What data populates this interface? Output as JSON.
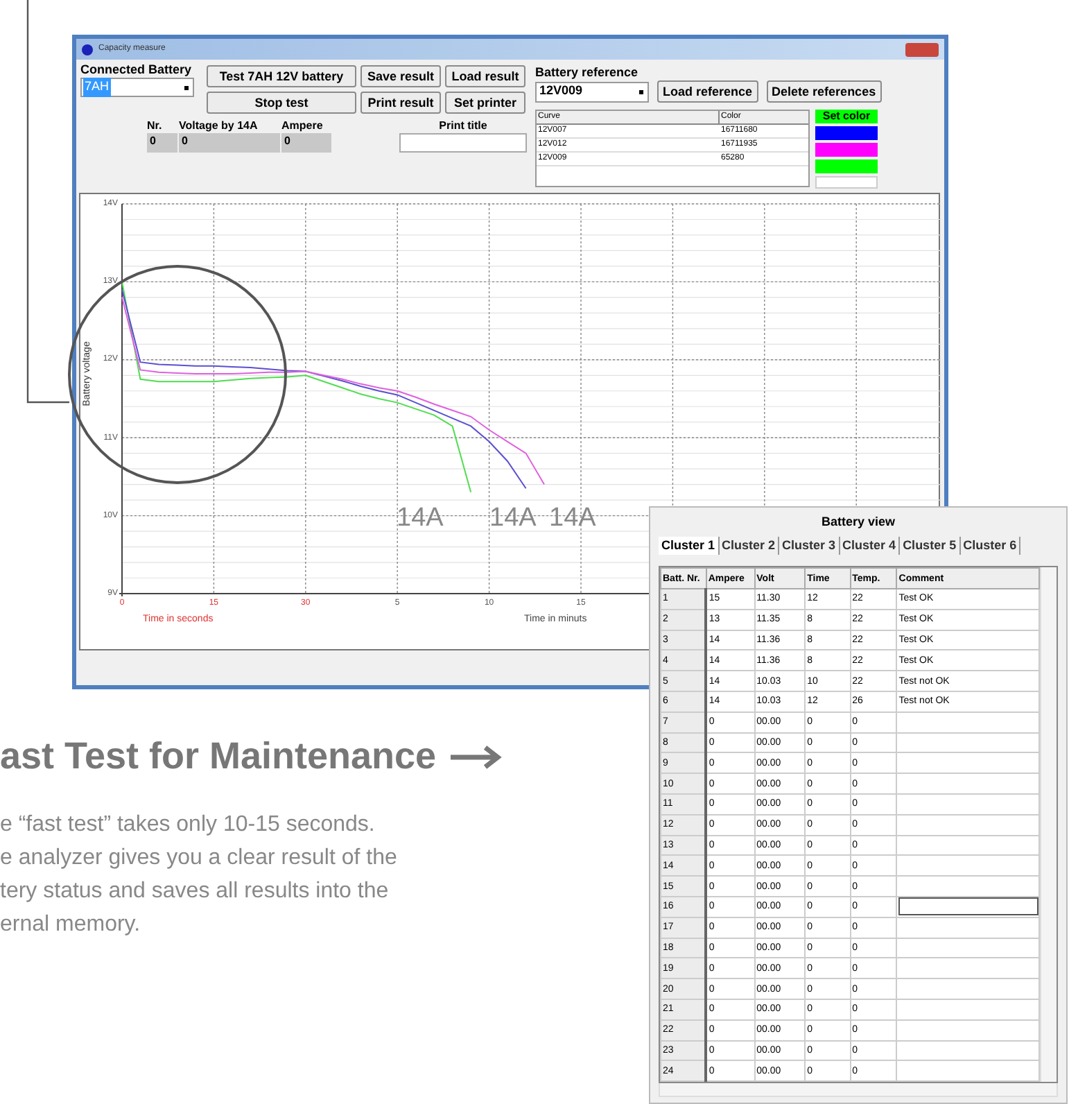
{
  "main_window": {
    "title": "Capacity measure",
    "connected_battery": {
      "label": "Connected Battery",
      "value": "7AH"
    },
    "buttons": [
      "Test 7AH 12V battery",
      "Save result",
      "Load result",
      "Stop test",
      "Print result",
      "Set printer"
    ],
    "readout": {
      "columns": [
        "Nr.",
        "Voltage by 14A",
        "Ampere"
      ],
      "values": [
        "0",
        "0",
        "0"
      ]
    },
    "print_title": {
      "label": "Print title"
    },
    "battery_reference": {
      "label": "Battery reference",
      "value": "12V009",
      "buttons": [
        "Load reference",
        "Delete references"
      ],
      "columns": [
        "Curve",
        "Color"
      ],
      "rows": [
        {
          "curve": "12V007",
          "code": "16711680",
          "color": "#0000ff"
        },
        {
          "curve": "12V012",
          "code": "16711935",
          "color": "#ff00ff"
        },
        {
          "curve": "12V009",
          "code": "65280",
          "color": "#00ff00"
        }
      ],
      "set_color_button": "Set color"
    }
  },
  "chart": {
    "xlabel_seconds": "Time in seconds",
    "xlabel_minutes": "Time in minuts",
    "curve_labels": [
      "14A",
      "14A",
      "14A"
    ],
    "chart_data": {
      "type": "line",
      "ylabel": "Battery voltage",
      "ylim": [
        9,
        14
      ],
      "grid": true,
      "yticks": [
        {
          "value": 14,
          "label": "14V"
        },
        {
          "value": 13,
          "label": "13V"
        },
        {
          "value": 12,
          "label": "12V"
        },
        {
          "value": 11,
          "label": "11V"
        },
        {
          "value": 10,
          "label": "10V"
        },
        {
          "value": 9,
          "label": "9V"
        }
      ],
      "categories": [
        "0",
        null,
        null,
        null,
        null,
        "15",
        null,
        null,
        null,
        null,
        "30",
        null,
        null,
        null,
        null,
        "5",
        null,
        null,
        null,
        null,
        "10",
        null,
        null,
        null,
        null,
        "15"
      ],
      "series": [
        {
          "color": "#50dd50",
          "values": [
            13.0,
            11.75,
            11.72,
            11.72,
            11.72,
            11.72,
            11.74,
            11.76,
            11.77,
            11.78,
            11.8,
            11.72,
            11.64,
            11.56,
            11.5,
            11.45,
            11.37,
            11.29,
            11.15,
            10.3,
            null,
            null,
            null,
            null,
            null,
            null
          ]
        },
        {
          "color": "#5a50d0",
          "values": [
            12.9,
            11.97,
            11.94,
            11.93,
            11.92,
            11.92,
            11.91,
            11.9,
            11.88,
            11.86,
            11.85,
            11.79,
            11.73,
            11.66,
            11.6,
            11.55,
            11.45,
            11.35,
            11.25,
            11.15,
            10.95,
            10.7,
            10.35,
            null,
            null,
            null
          ]
        },
        {
          "color": "#e060e0",
          "values": [
            12.8,
            11.87,
            11.84,
            11.83,
            11.82,
            11.82,
            11.82,
            11.83,
            11.84,
            11.84,
            11.85,
            11.8,
            11.75,
            11.69,
            11.64,
            11.6,
            11.52,
            11.43,
            11.35,
            11.27,
            11.1,
            10.95,
            10.8,
            10.4,
            null,
            null
          ]
        }
      ]
    }
  },
  "battery_view": {
    "title": "Battery view",
    "tabs": [
      {
        "label": "Cluster 1",
        "selected": true
      },
      {
        "label": "Cluster 2",
        "selected": false
      },
      {
        "label": "Cluster 3",
        "selected": false
      },
      {
        "label": "Cluster 4",
        "selected": false
      },
      {
        "label": "Cluster 5",
        "selected": false
      },
      {
        "label": "Cluster 6",
        "selected": false
      }
    ],
    "columns": [
      "Batt. Nr.",
      "Ampere",
      "Volt",
      "Time",
      "Temp.",
      "Comment"
    ],
    "rows": [
      {
        "cells": [
          "1",
          "15",
          "11.30",
          "12",
          "22",
          "Test OK"
        ],
        "editing": false
      },
      {
        "cells": [
          "2",
          "13",
          "11.35",
          "8",
          "22",
          "Test OK"
        ],
        "editing": false
      },
      {
        "cells": [
          "3",
          "14",
          "11.36",
          "8",
          "22",
          "Test OK"
        ],
        "editing": false
      },
      {
        "cells": [
          "4",
          "14",
          "11.36",
          "8",
          "22",
          "Test OK"
        ],
        "editing": false
      },
      {
        "cells": [
          "5",
          "14",
          "10.03",
          "10",
          "22",
          "Test not OK"
        ],
        "editing": false
      },
      {
        "cells": [
          "6",
          "14",
          "10.03",
          "12",
          "26",
          "Test not OK"
        ],
        "editing": false
      },
      {
        "cells": [
          "7",
          "0",
          "00.00",
          "0",
          "0"
        ],
        "editing": false
      },
      {
        "cells": [
          "8",
          "0",
          "00.00",
          "0",
          "0"
        ],
        "editing": false
      },
      {
        "cells": [
          "9",
          "0",
          "00.00",
          "0",
          "0"
        ],
        "editing": false
      },
      {
        "cells": [
          "10",
          "0",
          "00.00",
          "0",
          "0"
        ],
        "editing": false
      },
      {
        "cells": [
          "11",
          "0",
          "00.00",
          "0",
          "0"
        ],
        "editing": false
      },
      {
        "cells": [
          "12",
          "0",
          "00.00",
          "0",
          "0"
        ],
        "editing": false
      },
      {
        "cells": [
          "13",
          "0",
          "00.00",
          "0",
          "0"
        ],
        "editing": false
      },
      {
        "cells": [
          "14",
          "0",
          "00.00",
          "0",
          "0"
        ],
        "editing": false
      },
      {
        "cells": [
          "15",
          "0",
          "00.00",
          "0",
          "0"
        ],
        "editing": false
      },
      {
        "cells": [
          "16",
          "0",
          "00.00",
          "0",
          "0"
        ],
        "editing": true
      },
      {
        "cells": [
          "17",
          "0",
          "00.00",
          "0",
          "0"
        ],
        "editing": false
      },
      {
        "cells": [
          "18",
          "0",
          "00.00",
          "0",
          "0"
        ],
        "editing": false
      },
      {
        "cells": [
          "19",
          "0",
          "00.00",
          "0",
          "0"
        ],
        "editing": false
      },
      {
        "cells": [
          "20",
          "0",
          "00.00",
          "0",
          "0"
        ],
        "editing": false
      },
      {
        "cells": [
          "21",
          "0",
          "00.00",
          "0",
          "0"
        ],
        "editing": false
      },
      {
        "cells": [
          "22",
          "0",
          "00.00",
          "0",
          "0"
        ],
        "editing": false
      },
      {
        "cells": [
          "23",
          "0",
          "00.00",
          "0",
          "0"
        ],
        "editing": false
      },
      {
        "cells": [
          "24",
          "0",
          "00.00",
          "0",
          "0"
        ],
        "editing": false
      }
    ]
  },
  "feature": {
    "heading": "ast Test for Maintenance",
    "lines": [
      "e “fast test” takes only 10-15 seconds.",
      "e analyzer gives you a clear result of the",
      "tery status and saves all results into the",
      "ernal memory."
    ]
  }
}
